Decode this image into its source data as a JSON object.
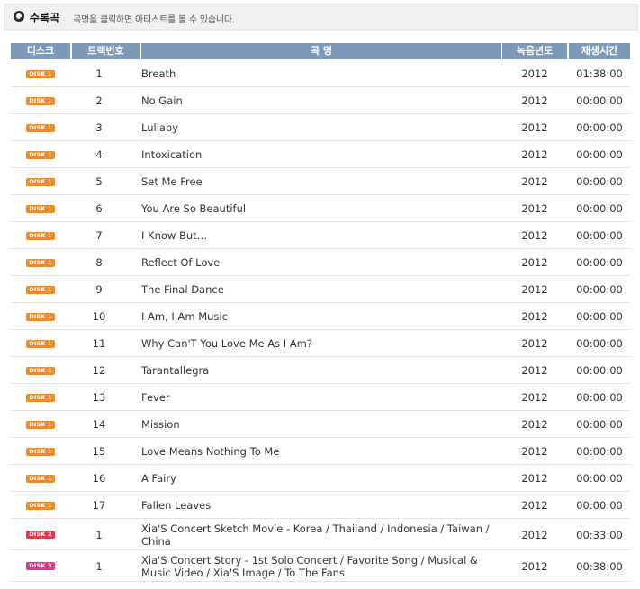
{
  "header": {
    "title": "수록곡",
    "subtitle": "곡명을 클릭하면 아티스트를 볼 수 있습니다."
  },
  "columns": {
    "disk": "디스크",
    "track": "트랙번호",
    "title": "곡 명",
    "year": "녹음년도",
    "time": "재생시간"
  },
  "badge_colors": {
    "1": "#f08a2c",
    "2": "#e23a4a",
    "3": "#e0388a"
  },
  "tracks": [
    {
      "disk_label": "DISK 1",
      "disk": "1",
      "track": "1",
      "title": "Breath",
      "year": "2012",
      "time": "01:38:00"
    },
    {
      "disk_label": "DISK 1",
      "disk": "1",
      "track": "2",
      "title": "No Gain",
      "year": "2012",
      "time": "00:00:00"
    },
    {
      "disk_label": "DISK 1",
      "disk": "1",
      "track": "3",
      "title": "Lullaby",
      "year": "2012",
      "time": "00:00:00"
    },
    {
      "disk_label": "DISK 1",
      "disk": "1",
      "track": "4",
      "title": "Intoxication",
      "year": "2012",
      "time": "00:00:00"
    },
    {
      "disk_label": "DISK 1",
      "disk": "1",
      "track": "5",
      "title": "Set Me Free",
      "year": "2012",
      "time": "00:00:00"
    },
    {
      "disk_label": "DISK 1",
      "disk": "1",
      "track": "6",
      "title": "You Are So Beautiful",
      "year": "2012",
      "time": "00:00:00"
    },
    {
      "disk_label": "DISK 1",
      "disk": "1",
      "track": "7",
      "title": "I Know But…",
      "year": "2012",
      "time": "00:00:00"
    },
    {
      "disk_label": "DISK 1",
      "disk": "1",
      "track": "8",
      "title": "Reflect Of Love",
      "year": "2012",
      "time": "00:00:00"
    },
    {
      "disk_label": "DISK 1",
      "disk": "1",
      "track": "9",
      "title": "The Final Dance",
      "year": "2012",
      "time": "00:00:00"
    },
    {
      "disk_label": "DISK 1",
      "disk": "1",
      "track": "10",
      "title": "I Am, I Am Music",
      "year": "2012",
      "time": "00:00:00"
    },
    {
      "disk_label": "DISK 1",
      "disk": "1",
      "track": "11",
      "title": "Why Can'T You Love Me As I Am?",
      "year": "2012",
      "time": "00:00:00"
    },
    {
      "disk_label": "DISK 1",
      "disk": "1",
      "track": "12",
      "title": "Tarantallegra",
      "year": "2012",
      "time": "00:00:00"
    },
    {
      "disk_label": "DISK 1",
      "disk": "1",
      "track": "13",
      "title": "Fever",
      "year": "2012",
      "time": "00:00:00"
    },
    {
      "disk_label": "DISK 1",
      "disk": "1",
      "track": "14",
      "title": "Mission",
      "year": "2012",
      "time": "00:00:00"
    },
    {
      "disk_label": "DISK 1",
      "disk": "1",
      "track": "15",
      "title": "Love Means Nothing To Me",
      "year": "2012",
      "time": "00:00:00"
    },
    {
      "disk_label": "DISK 1",
      "disk": "1",
      "track": "16",
      "title": "A Fairy",
      "year": "2012",
      "time": "00:00:00"
    },
    {
      "disk_label": "DISK 1",
      "disk": "1",
      "track": "17",
      "title": "Fallen Leaves",
      "year": "2012",
      "time": "00:00:00"
    },
    {
      "disk_label": "DISK 2",
      "disk": "2",
      "track": "1",
      "title": "Xia'S Concert Sketch Movie - Korea / Thailand / Indonesia / Taiwan / China",
      "year": "2012",
      "time": "00:33:00"
    },
    {
      "disk_label": "DISK 3",
      "disk": "3",
      "track": "1",
      "title": "Xia'S Concert Story - 1st Solo Concert / Favorite Song / Musical & Music Video / Xia'S Image / To The Fans",
      "year": "2012",
      "time": "00:38:00"
    }
  ]
}
